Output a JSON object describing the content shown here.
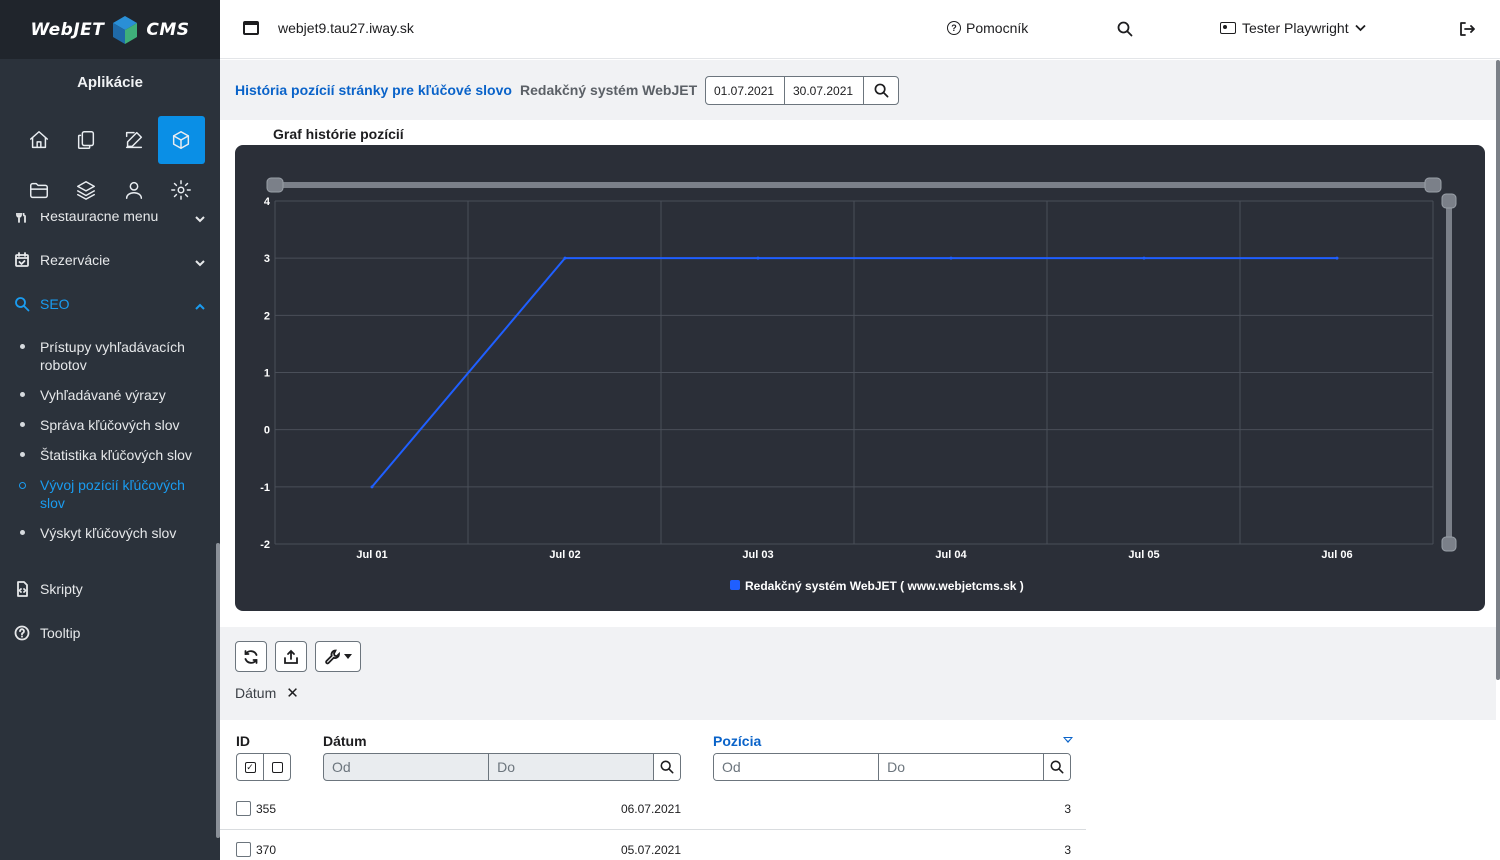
{
  "app": {
    "logo_left": "WebJET",
    "logo_right": "CMS",
    "section_title": "Aplikácie"
  },
  "sidebar": {
    "menu": [
      {
        "label": "Reštauračné menu",
        "icon": "restaurant-icon"
      },
      {
        "label": "Rezervácie",
        "icon": "calendar-check-icon"
      },
      {
        "label": "SEO",
        "icon": "seo-search-icon"
      }
    ],
    "seo_items": [
      {
        "label": "Prístupy vyhľadávacích robotov"
      },
      {
        "label": "Vyhľadávané výrazy"
      },
      {
        "label": "Správa kľúčových slov"
      },
      {
        "label": "Štatistika kľúčových slov"
      },
      {
        "label": "Vývoj pozícií kľúčových slov"
      },
      {
        "label": "Výskyt kľúčových slov"
      }
    ],
    "bottom": [
      {
        "label": "Skripty",
        "icon": "script-icon"
      },
      {
        "label": "Tooltip",
        "icon": "help-circle-icon"
      }
    ]
  },
  "topbar": {
    "domain": "webjet9.tau27.iway.sk",
    "help": "Pomocník",
    "user": "Tester Playwright"
  },
  "header": {
    "title": "História pozícií stránky pre kľúčové slovo",
    "site": "Redakčný systém WebJET",
    "date_from": "01.07.2021",
    "date_to": "30.07.2021"
  },
  "chart_heading": "Graf histórie pozícií",
  "chart_data": {
    "type": "line",
    "title": "Graf histórie pozícií",
    "categories": [
      "Jul 01",
      "Jul 02",
      "Jul 03",
      "Jul 04",
      "Jul 05",
      "Jul 06"
    ],
    "series": [
      {
        "name": "Redakčný systém WebJET ( www.webjetcms.sk )",
        "values": [
          -1,
          3,
          3,
          3,
          3,
          3
        ],
        "color": "#1f5fff"
      }
    ],
    "y_ticks": [
      4,
      3,
      2,
      1,
      0,
      -1,
      -2
    ],
    "ylim": [
      -2,
      4
    ],
    "grid": true,
    "legend": "bottom"
  },
  "toolbar": {
    "filter_chip": "Dátum"
  },
  "table": {
    "headers": {
      "id": "ID",
      "date": "Dátum",
      "position": "Pozícia"
    },
    "placeholders": {
      "from": "Od",
      "to": "Do"
    },
    "rows": [
      {
        "id": "355",
        "date": "06.07.2021",
        "position": "3"
      },
      {
        "id": "370",
        "date": "05.07.2021",
        "position": "3"
      }
    ]
  },
  "colors": {
    "accent": "#0a8fe6",
    "link": "#0a63c9",
    "sidebar": "#2b323b",
    "chart_bg": "#2b2f38",
    "series": "#1f5fff"
  }
}
